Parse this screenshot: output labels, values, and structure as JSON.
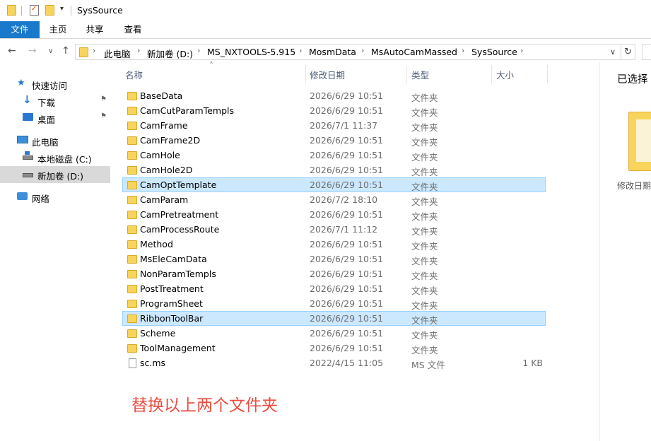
{
  "window": {
    "title": "SysSource",
    "qat_dropdown": "▾"
  },
  "ribbon": {
    "tabs": [
      "文件",
      "主页",
      "共享",
      "查看"
    ]
  },
  "address": {
    "crumbs": [
      "此电脑",
      "新加卷 (D:)",
      "MS_NXTOOLS-5.915",
      "MosmData",
      "MsAutoCamMassed",
      "SysSource"
    ],
    "chevron": "›",
    "dropdown": "∨",
    "refresh": "↻"
  },
  "nav": {
    "back": "←",
    "forward": "→",
    "recent": "∨",
    "up": "↑",
    "items": [
      {
        "label": "快速访问"
      },
      {
        "label": "下载"
      },
      {
        "label": "桌面"
      },
      {
        "label": "此电脑"
      },
      {
        "label": "本地磁盘 (C:)"
      },
      {
        "label": "新加卷 (D:)"
      },
      {
        "label": "网络"
      }
    ],
    "pin_glyph": "⚑"
  },
  "columns": {
    "name": "名称",
    "date": "修改日期",
    "type": "类型",
    "size": "大小",
    "sort_arrow": "˄"
  },
  "files": [
    {
      "name": "BaseData",
      "date": "2026/6/29 10:51",
      "type": "文件夹",
      "size": "",
      "selected": false,
      "kind": "folder"
    },
    {
      "name": "CamCutParamTempls",
      "date": "2026/6/29 10:51",
      "type": "文件夹",
      "size": "",
      "selected": false,
      "kind": "folder"
    },
    {
      "name": "CamFrame",
      "date": "2026/7/1 11:37",
      "type": "文件夹",
      "size": "",
      "selected": false,
      "kind": "folder"
    },
    {
      "name": "CamFrame2D",
      "date": "2026/6/29 10:51",
      "type": "文件夹",
      "size": "",
      "selected": false,
      "kind": "folder"
    },
    {
      "name": "CamHole",
      "date": "2026/6/29 10:51",
      "type": "文件夹",
      "size": "",
      "selected": false,
      "kind": "folder"
    },
    {
      "name": "CamHole2D",
      "date": "2026/6/29 10:51",
      "type": "文件夹",
      "size": "",
      "selected": false,
      "kind": "folder"
    },
    {
      "name": "CamOptTemplate",
      "date": "2026/6/29 10:51",
      "type": "文件夹",
      "size": "",
      "selected": true,
      "kind": "folder"
    },
    {
      "name": "CamParam",
      "date": "2026/7/2 18:10",
      "type": "文件夹",
      "size": "",
      "selected": false,
      "kind": "folder"
    },
    {
      "name": "CamPretreatment",
      "date": "2026/6/29 10:51",
      "type": "文件夹",
      "size": "",
      "selected": false,
      "kind": "folder"
    },
    {
      "name": "CamProcessRoute",
      "date": "2026/7/1 11:12",
      "type": "文件夹",
      "size": "",
      "selected": false,
      "kind": "folder"
    },
    {
      "name": "Method",
      "date": "2026/6/29 10:51",
      "type": "文件夹",
      "size": "",
      "selected": false,
      "kind": "folder"
    },
    {
      "name": "MsEleCamData",
      "date": "2026/6/29 10:51",
      "type": "文件夹",
      "size": "",
      "selected": false,
      "kind": "folder"
    },
    {
      "name": "NonParamTempls",
      "date": "2026/6/29 10:51",
      "type": "文件夹",
      "size": "",
      "selected": false,
      "kind": "folder"
    },
    {
      "name": "PostTreatment",
      "date": "2026/6/29 10:51",
      "type": "文件夹",
      "size": "",
      "selected": false,
      "kind": "folder"
    },
    {
      "name": "ProgramSheet",
      "date": "2026/6/29 10:51",
      "type": "文件夹",
      "size": "",
      "selected": false,
      "kind": "folder"
    },
    {
      "name": "RibbonToolBar",
      "date": "2026/6/29 10:51",
      "type": "文件夹",
      "size": "",
      "selected": true,
      "kind": "folder"
    },
    {
      "name": "Scheme",
      "date": "2026/6/29 10:51",
      "type": "文件夹",
      "size": "",
      "selected": false,
      "kind": "folder"
    },
    {
      "name": "ToolManagement",
      "date": "2026/6/29 10:51",
      "type": "文件夹",
      "size": "",
      "selected": false,
      "kind": "folder"
    },
    {
      "name": "sc.ms",
      "date": "2022/4/15 11:05",
      "type": "MS 文件",
      "size": "1 KB",
      "selected": false,
      "kind": "file"
    }
  ],
  "annotation": "替换以上两个文件夹",
  "preview": {
    "title": "已选择",
    "label": "修改日期"
  },
  "colors": {
    "accent": "#1979ca",
    "selection": "#cce8ff",
    "selection_border": "#99d1ff",
    "annotation": "#ee4b3f",
    "folder": "#f8d45c"
  }
}
